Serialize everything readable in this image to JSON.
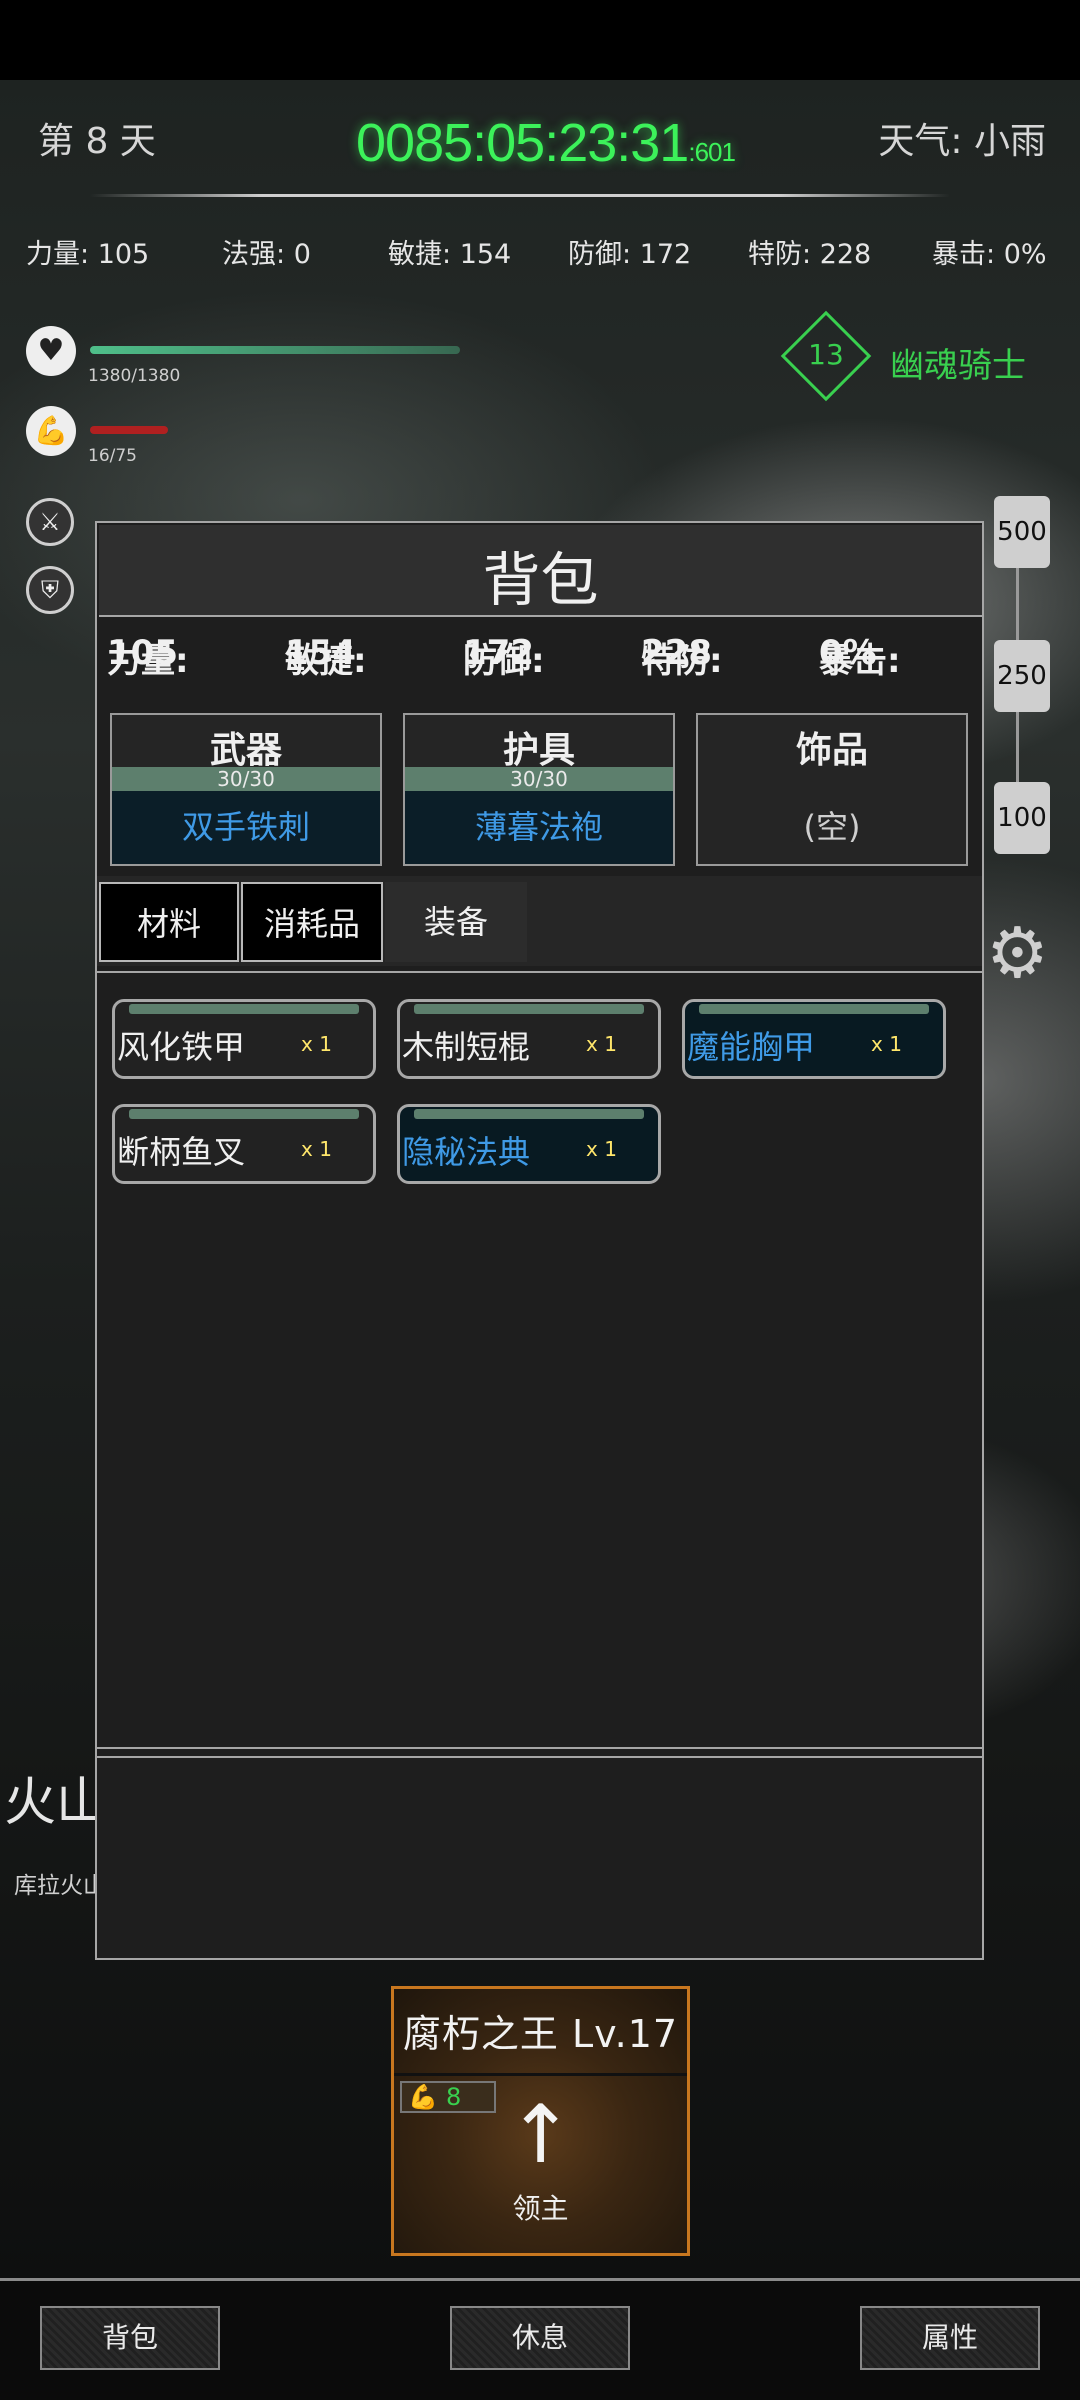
{
  "hud": {
    "day": "第 8 天",
    "clock_main": "0085:05:23:31",
    "clock_ms": ":601",
    "weather": "天气: 小雨"
  },
  "stats": [
    {
      "label": "力量:",
      "value": "105"
    },
    {
      "label": "法强:",
      "value": "0"
    },
    {
      "label": "敏捷:",
      "value": "154"
    },
    {
      "label": "防御:",
      "value": "172"
    },
    {
      "label": "特防:",
      "value": "228"
    },
    {
      "label": "暴击:",
      "value": "0%"
    }
  ],
  "player": {
    "hp_text": "1380/1380",
    "stamina_text": "16/75",
    "hp_fraction": 1.0,
    "stamina_fraction": 0.21,
    "hp_bar_color": "#4fbf8a",
    "stamina_bar_color": "#b02020"
  },
  "enemy": {
    "level": "13",
    "name": "幽魂骑士",
    "color": "#39d04f"
  },
  "scale": {
    "tags": [
      "500",
      "250",
      "100"
    ]
  },
  "location": {
    "title": "火山",
    "subtitle": "库拉火山"
  },
  "backpack": {
    "title": "背包",
    "stats": [
      {
        "label": "力量:",
        "value": "105"
      },
      {
        "label": "敏捷:",
        "value": "154"
      },
      {
        "label": "防御:",
        "value": "172"
      },
      {
        "label": "特防:",
        "value": "228"
      },
      {
        "label": "暴击:",
        "value": "0%"
      }
    ],
    "slots": [
      {
        "title": "武器",
        "durability": "30/30",
        "item": "双手铁刺"
      },
      {
        "title": "护具",
        "durability": "30/30",
        "item": "薄暮法袍"
      },
      {
        "title": "饰品",
        "durability": "",
        "item": "(空)"
      }
    ],
    "tabs": [
      "材料",
      "消耗品",
      "装备"
    ],
    "active_tab": "材料",
    "items": [
      {
        "name": "风化铁甲",
        "count": "x 1",
        "rare": false
      },
      {
        "name": "木制短棍",
        "count": "x 1",
        "rare": false
      },
      {
        "name": "魔能胸甲",
        "count": "x 1",
        "rare": true
      },
      {
        "name": "断柄鱼叉",
        "count": "x 1",
        "rare": false
      },
      {
        "name": "隐秘法典",
        "count": "x 1",
        "rare": true
      }
    ],
    "rare_color": "#3f9ae6"
  },
  "boss": {
    "title": "腐朽之王 Lv.17",
    "badge_value": "8",
    "label": "领主",
    "border_color": "#c8771f"
  },
  "bottom_buttons": [
    "背包",
    "休息",
    "属性"
  ]
}
